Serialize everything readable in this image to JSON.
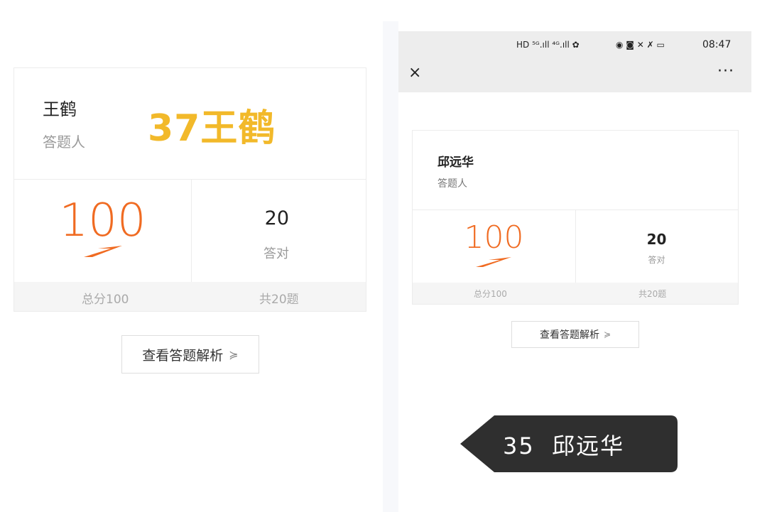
{
  "left": {
    "participant_name": "王鹤",
    "participant_role": "答题人",
    "overlay_label": "37王鹤",
    "score": "100",
    "correct_count": "20",
    "correct_label": "答对",
    "total_score": "总分100",
    "question_count": "共20题",
    "view_analysis_button": "查看答题解析",
    "chevron": "≽"
  },
  "phone": {
    "status_icons": "HD ⁵ᴳ.ıll ⁴ᴳ.ıll ✿",
    "status_icons_right": "◉ ◙ ✕ ✗ ▭",
    "time": "08:47",
    "close_glyph": "×",
    "more_glyph": "···",
    "participant_name": "邱远华",
    "participant_role": "答题人",
    "score": "100",
    "correct_count": "20",
    "correct_label": "答对",
    "total_score": "总分100",
    "question_count": "共20题",
    "view_analysis_button": "查看答题解析",
    "chevron": "≽",
    "tooltip_label": "35  邱远华"
  },
  "colors": {
    "score_orange": "#f06b22",
    "overlay_yellow": "#f2b92a",
    "tooltip_bg": "#2f2f2f"
  }
}
